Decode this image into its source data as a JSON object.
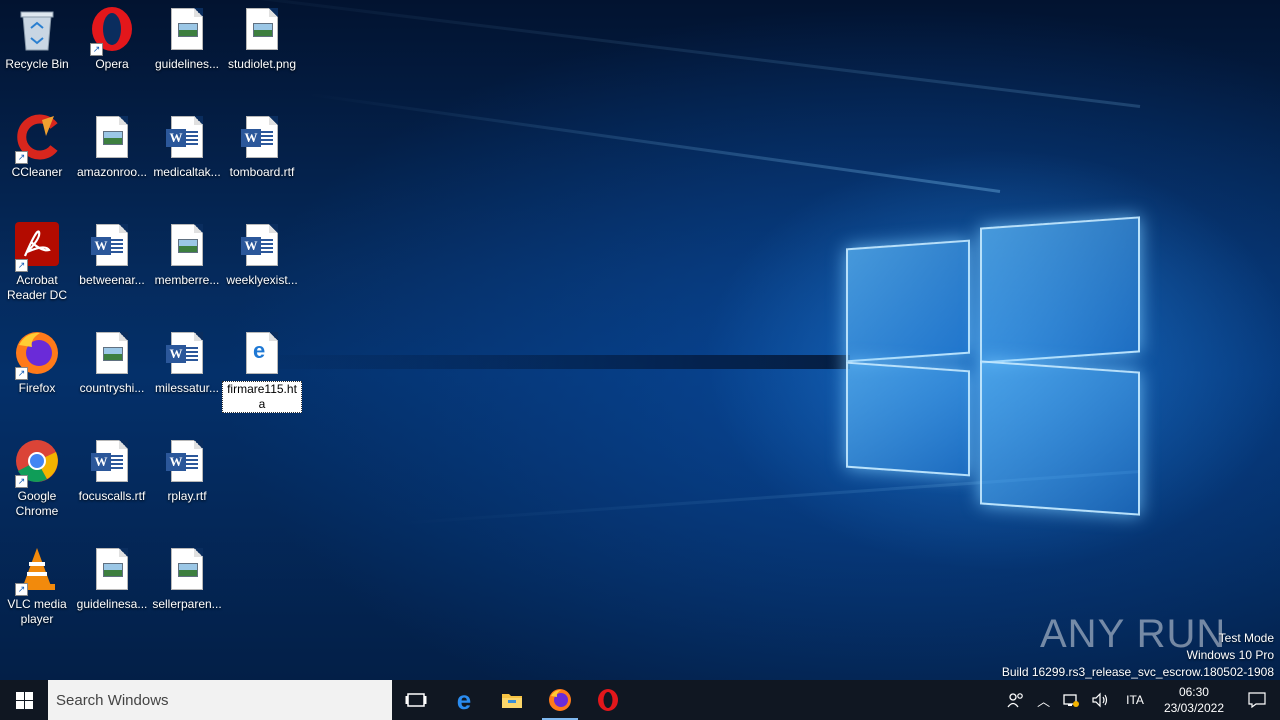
{
  "desktop": {
    "icons": [
      {
        "label": "Recycle Bin",
        "kind": "recycle-bin",
        "col": 0,
        "row": 0,
        "shortcut": false
      },
      {
        "label": "Opera",
        "kind": "opera",
        "col": 1,
        "row": 0,
        "shortcut": true
      },
      {
        "label": "guidelines...",
        "kind": "image-file",
        "col": 2,
        "row": 0,
        "shortcut": false
      },
      {
        "label": "studiolet.png",
        "kind": "image-file",
        "col": 3,
        "row": 0,
        "shortcut": false
      },
      {
        "label": "CCleaner",
        "kind": "ccleaner",
        "col": 0,
        "row": 1,
        "shortcut": true
      },
      {
        "label": "amazonroo...",
        "kind": "image-file",
        "col": 1,
        "row": 1,
        "shortcut": false
      },
      {
        "label": "medicaltak...",
        "kind": "word-file",
        "col": 2,
        "row": 1,
        "shortcut": false
      },
      {
        "label": "tomboard.rtf",
        "kind": "word-file",
        "col": 3,
        "row": 1,
        "shortcut": false
      },
      {
        "label": "Acrobat Reader DC",
        "kind": "acrobat",
        "col": 0,
        "row": 2,
        "shortcut": true
      },
      {
        "label": "betweenar...",
        "kind": "word-file",
        "col": 1,
        "row": 2,
        "shortcut": false
      },
      {
        "label": "memberre...",
        "kind": "image-file",
        "col": 2,
        "row": 2,
        "shortcut": false
      },
      {
        "label": "weeklyexist...",
        "kind": "word-file",
        "col": 3,
        "row": 2,
        "shortcut": false
      },
      {
        "label": "Firefox",
        "kind": "firefox",
        "col": 0,
        "row": 3,
        "shortcut": true
      },
      {
        "label": "countryshi...",
        "kind": "image-file",
        "col": 1,
        "row": 3,
        "shortcut": false
      },
      {
        "label": "milessatur...",
        "kind": "word-file",
        "col": 2,
        "row": 3,
        "shortcut": false
      },
      {
        "label": "firmare115.hta",
        "kind": "hta-file",
        "col": 3,
        "row": 3,
        "shortcut": false,
        "selected": true
      },
      {
        "label": "Google Chrome",
        "kind": "chrome",
        "col": 0,
        "row": 4,
        "shortcut": true
      },
      {
        "label": "focuscalls.rtf",
        "kind": "word-file",
        "col": 1,
        "row": 4,
        "shortcut": false
      },
      {
        "label": "rplay.rtf",
        "kind": "word-file",
        "col": 2,
        "row": 4,
        "shortcut": false
      },
      {
        "label": "VLC media player",
        "kind": "vlc",
        "col": 0,
        "row": 5,
        "shortcut": true
      },
      {
        "label": "guidelinesa...",
        "kind": "image-file",
        "col": 1,
        "row": 5,
        "shortcut": false
      },
      {
        "label": "sellerparen...",
        "kind": "image-file",
        "col": 2,
        "row": 5,
        "shortcut": false
      }
    ]
  },
  "watermark": {
    "brand": "ANY RUN",
    "line1": "Test Mode",
    "line2": "Windows 10 Pro",
    "line3": "Build 16299.rs3_release_svc_escrow.180502-1908"
  },
  "taskbar": {
    "search_placeholder": "Search Windows",
    "pinned": [
      {
        "name": "task-view-icon"
      },
      {
        "name": "edge-icon"
      },
      {
        "name": "file-explorer-icon"
      },
      {
        "name": "firefox-icon"
      },
      {
        "name": "opera-icon"
      }
    ],
    "tray": {
      "language": "ITA",
      "time": "06:30",
      "date": "23/03/2022"
    }
  }
}
